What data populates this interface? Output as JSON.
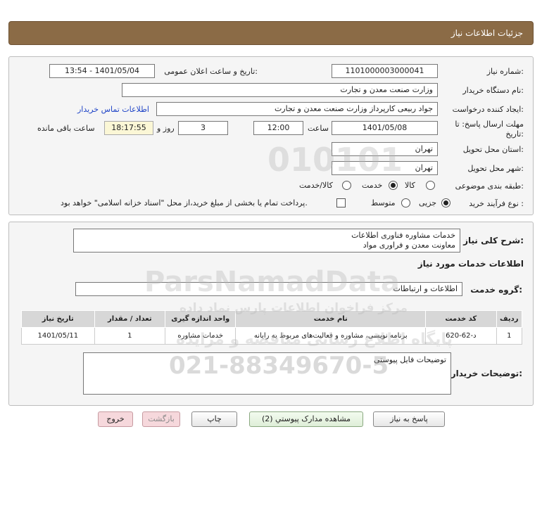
{
  "page": {
    "title": "جزئیات اطلاعات نیاز"
  },
  "form": {
    "need_number_label": "شماره نیاز:",
    "need_number": "1101000003000041",
    "announce_label": "تاریخ و ساعت اعلان عمومی:",
    "announce_value": "1401/05/04 - 13:54",
    "buyer_org_label": "نام دستگاه خریدار:",
    "buyer_org": "وزارت صنعت معدن و تجارت",
    "creator_label": "ایجاد کننده درخواست:",
    "creator": "جواد ربیعی کارپرداز وزارت صنعت معدن و تجارت",
    "contact_link": "اطلاعات تماس خریدار",
    "deadline_label_1": "مهلت ارسال پاسخ: تا",
    "deadline_label_2": "تاریخ:",
    "deadline_date": "1401/05/08",
    "time_label": "ساعت",
    "deadline_time": "12:00",
    "days_value": "3",
    "days_label": "روز و",
    "remaining_time": "18:17:55",
    "remaining_label": "ساعت باقی مانده",
    "province_label": "استان محل تحویل:",
    "province": "تهران",
    "city_label": "شهر محل تحویل:",
    "city": "تهران",
    "category_label": "طبقه بندی موضوعی:",
    "category_options": [
      "کالا",
      "خدمت",
      "کالا/خدمت"
    ],
    "category_selected": "خدمت",
    "process_label": "نوع فرآیند خرید :",
    "process_options": [
      "جزیی",
      "متوسط"
    ],
    "process_selected": "جزیی",
    "payment_note": "پرداخت تمام یا بخشی از مبلغ خرید،از محل \"اسناد خزانه اسلامی\" خواهد بود."
  },
  "description": {
    "label": "شرح کلی نیاز:",
    "line1": "خدمات مشاوره فناوری اطلاعات",
    "line2": "معاونت معدن و فراوری مواد"
  },
  "services": {
    "section_title": "اطلاعات خدمات مورد نیاز",
    "group_label": "گروه خدمت:",
    "group_value": "اطلاعات و ارتباطات",
    "table": {
      "headers": [
        "ردیف",
        "کد خدمت",
        "نام خدمت",
        "واحد اندازه گیری",
        "تعداد / مقدار",
        "تاریخ نیاز"
      ],
      "rows": [
        [
          "1",
          "د-62-620",
          "برنامه نویسی، مشاوره و فعالیت‌های مربوط به رایانه",
          "خدمات مشاوره",
          "1",
          "1401/05/11"
        ]
      ]
    }
  },
  "buyer_notes": {
    "label": "توضیحات خریدار:",
    "text": "توضیحات فایل پیوستی"
  },
  "buttons": {
    "reply": "پاسخ به نیاز",
    "attachments": "مشاهده مدارک پیوستي (2)",
    "print": "چاپ",
    "back": "بازگشت",
    "exit": "خروج"
  },
  "watermark": {
    "brand": "ParsNamadData",
    "code": "010101",
    "phone": "021-88349670-5",
    "line1": "مرکز فراخوان اطلاعات پارس نماد داده",
    "line2": "پایگاه اطلاع رسانی مناقصه و مزایده"
  },
  "colors": {
    "title_bar": "#8b6b46",
    "panel_bg": "#f5f5f5",
    "link": "#1f44c7",
    "remaining_bg": "#fbf7d6",
    "exit_button": "#f6d8dc",
    "attachments_button": "#dfeed8"
  }
}
